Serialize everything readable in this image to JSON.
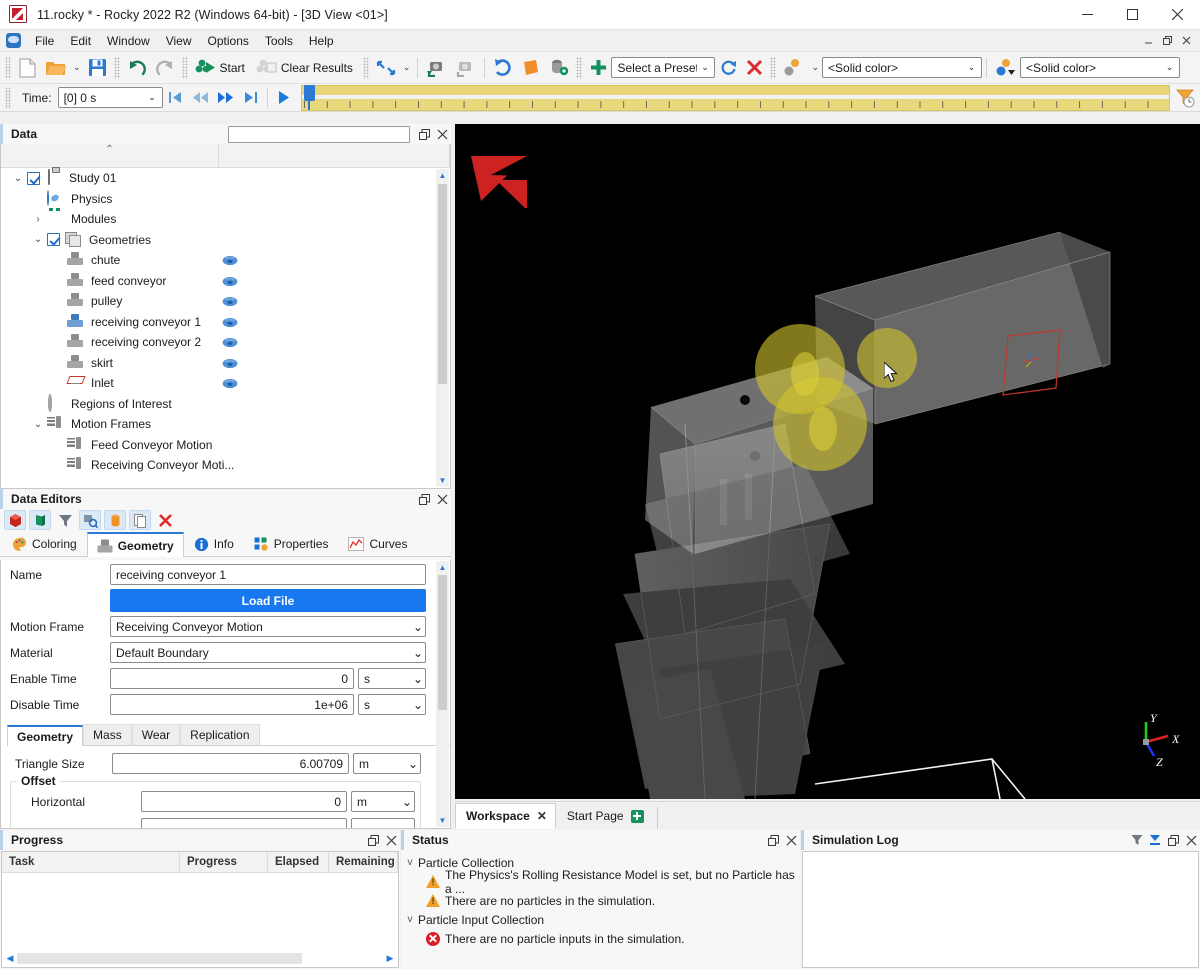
{
  "window": {
    "title": "11.rocky * - Rocky 2022 R2 (Windows 64-bit) - [3D View <01>]",
    "app_icon": "rocky-logo-icon",
    "minimize": "–",
    "maximize": "▢",
    "close": "✕",
    "mdi_minimize": "–",
    "mdi_restore": "❐",
    "mdi_close": "✕"
  },
  "menu": {
    "items": [
      "File",
      "Edit",
      "Window",
      "View",
      "Options",
      "Tools",
      "Help"
    ]
  },
  "toolbar": {
    "new_label": "New",
    "open_label": "Open",
    "save_label": "Save",
    "undo_label": "Undo",
    "redo_label": "Redo",
    "start_label": "Start",
    "clear_results_label": "Clear Results",
    "preset_combo": "Select a Preset",
    "solid_color_1": "<Solid color>",
    "solid_color_2": "<Solid color>"
  },
  "timebar": {
    "time_label": "Time:",
    "time_value": "[0] 0 s",
    "first_label": "First",
    "prev_label": "Previous",
    "next_label": "Next",
    "last_label": "Last",
    "play_label": "Play",
    "slider_position_pct": 0
  },
  "data_panel": {
    "title": "Data",
    "search_value": "",
    "tree": [
      {
        "label": "Study 01",
        "indent": 0,
        "expander": "v",
        "checkbox": true,
        "icon": "clipboard-icon",
        "eye": false
      },
      {
        "label": "Physics",
        "indent": 1,
        "expander": "",
        "checkbox": false,
        "icon": "physics-icon",
        "eye": false
      },
      {
        "label": "Modules",
        "indent": 1,
        "expander": ">",
        "checkbox": false,
        "icon": "modules-icon",
        "eye": false
      },
      {
        "label": "Geometries",
        "indent": 1,
        "expander": "v",
        "checkbox": true,
        "icon": "geometries-icon",
        "eye": false
      },
      {
        "label": "chute",
        "indent": 2,
        "expander": "",
        "checkbox": false,
        "icon": "geometry-icon",
        "eye": true
      },
      {
        "label": "feed conveyor",
        "indent": 2,
        "expander": "",
        "checkbox": false,
        "icon": "geometry-icon",
        "eye": true
      },
      {
        "label": "pulley",
        "indent": 2,
        "expander": "",
        "checkbox": false,
        "icon": "geometry-icon",
        "eye": true
      },
      {
        "label": "receiving conveyor 1",
        "indent": 2,
        "expander": "",
        "checkbox": false,
        "icon": "geometry-icon-selected",
        "eye": true
      },
      {
        "label": "receiving conveyor 2",
        "indent": 2,
        "expander": "",
        "checkbox": false,
        "icon": "geometry-icon",
        "eye": true
      },
      {
        "label": "skirt",
        "indent": 2,
        "expander": "",
        "checkbox": false,
        "icon": "geometry-icon",
        "eye": true
      },
      {
        "label": "Inlet",
        "indent": 2,
        "expander": "",
        "checkbox": false,
        "icon": "inlet-icon",
        "eye": true
      },
      {
        "label": "Regions of Interest",
        "indent": 1,
        "expander": "",
        "checkbox": false,
        "icon": "region-of-interest-icon",
        "eye": false
      },
      {
        "label": "Motion Frames",
        "indent": 1,
        "expander": "v",
        "checkbox": false,
        "icon": "motion-frame-icon",
        "eye": false
      },
      {
        "label": "Feed Conveyor Motion",
        "indent": 2,
        "expander": "",
        "checkbox": false,
        "icon": "motion-frame-icon",
        "eye": false
      },
      {
        "label": "Receiving Conveyor Moti...",
        "indent": 2,
        "expander": "",
        "checkbox": false,
        "icon": "motion-frame-icon",
        "eye": false
      }
    ]
  },
  "data_editors": {
    "title": "Data Editors",
    "toolbar_icons": [
      "red-cube-icon",
      "green-shape-icon",
      "filter-funnel-icon",
      "search-selection-icon",
      "orange-cylinder-icon",
      "copy-page-icon",
      "delete-red-x-icon"
    ],
    "tabs": [
      {
        "label": "Coloring",
        "icon": "palette-icon",
        "active": false
      },
      {
        "label": "Geometry",
        "icon": "geometry-icon",
        "active": true
      },
      {
        "label": "Info",
        "icon": "info-icon",
        "active": false
      },
      {
        "label": "Properties",
        "icon": "properties-icon",
        "active": false
      },
      {
        "label": "Curves",
        "icon": "curves-icon",
        "active": false
      }
    ],
    "fields": {
      "name_label": "Name",
      "name_value": "receiving conveyor 1",
      "load_file_label": "Load File",
      "motion_frame_label": "Motion Frame",
      "motion_frame_value": "Receiving Conveyor Motion",
      "material_label": "Material",
      "material_value": "Default Boundary",
      "enable_time_label": "Enable Time",
      "enable_time_value": "0",
      "enable_time_unit": "s",
      "disable_time_label": "Disable Time",
      "disable_time_value": "1e+06",
      "disable_time_unit": "s"
    },
    "subtabs": [
      {
        "label": "Geometry",
        "active": true
      },
      {
        "label": "Mass",
        "active": false
      },
      {
        "label": "Wear",
        "active": false
      },
      {
        "label": "Replication",
        "active": false
      }
    ],
    "geometry_tab": {
      "triangle_size_label": "Triangle Size",
      "triangle_size_value": "6.00709",
      "triangle_size_unit": "m",
      "offset_group_label": "Offset",
      "horizontal_label": "Horizontal",
      "horizontal_value": "0",
      "horizontal_unit": "m"
    }
  },
  "view3d": {
    "logo": "rocky-watermark-logo",
    "background_color": "#000000",
    "axis_triad": {
      "x_label": "X",
      "x_color": "#e02020",
      "y_label": "Y",
      "y_color": "#22cc22",
      "z_label": "Z",
      "z_color": "#2233ee"
    },
    "tabs": [
      {
        "label": "Workspace",
        "active": true,
        "closable": true,
        "add": false
      },
      {
        "label": "Start Page",
        "active": false,
        "closable": false,
        "add": true
      }
    ]
  },
  "progress_panel": {
    "title": "Progress",
    "columns": [
      "Task",
      "Progress",
      "Elapsed",
      "Remaining"
    ],
    "rows": []
  },
  "status_panel": {
    "title": "Status",
    "groups": [
      {
        "label": "Particle Collection",
        "expander": "v",
        "items": [
          {
            "severity": "warning",
            "text": "The Physics's Rolling Resistance Model is set, but no Particle has a ..."
          },
          {
            "severity": "warning",
            "text": "There are no particles in the simulation."
          }
        ]
      },
      {
        "label": "Particle Input Collection",
        "expander": "v",
        "items": [
          {
            "severity": "error",
            "text": "There are no particle inputs in the simulation."
          }
        ]
      }
    ]
  },
  "log_panel": {
    "title": "Simulation Log",
    "content": "",
    "tools": [
      "filter-funnel-icon",
      "download-icon",
      "float-icon",
      "close-icon"
    ]
  },
  "colors": {
    "accent_blue": "#1878f0",
    "warning_orange": "#f0a02a",
    "error_red": "#d8202a",
    "brand_red": "#c5202e",
    "timeline_yellow": "#e9d97e"
  }
}
